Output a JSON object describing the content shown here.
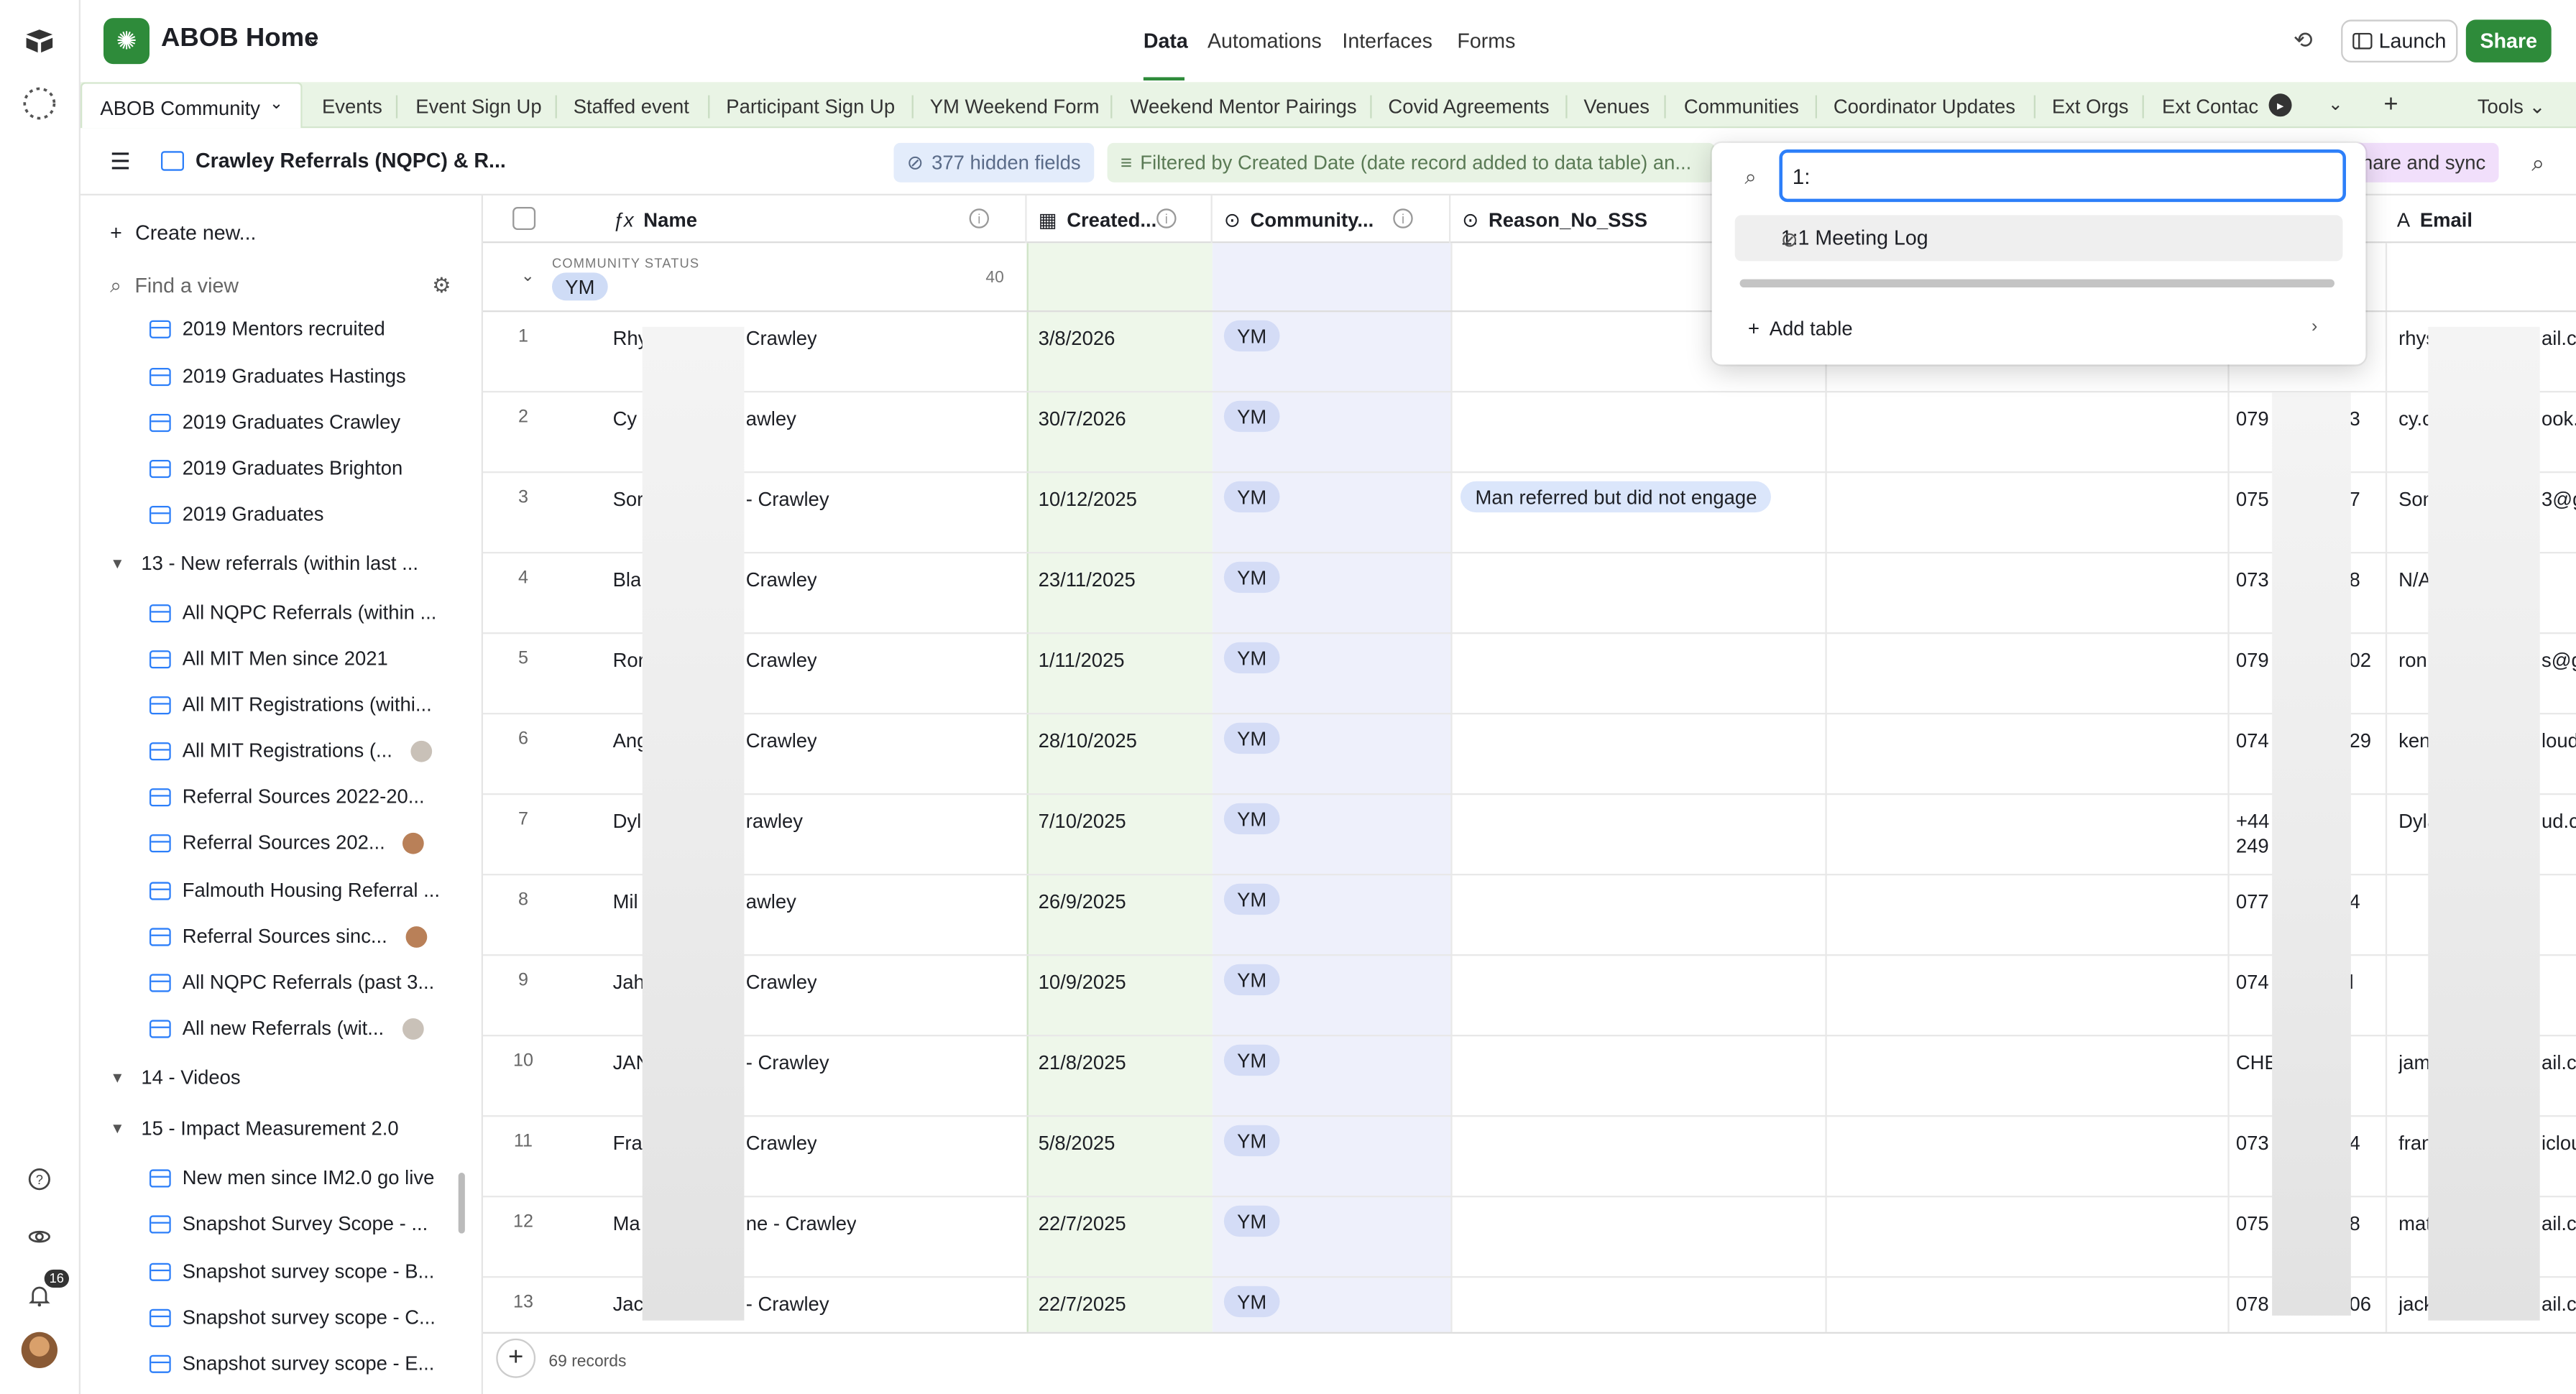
{
  "app": {
    "name": "ABOB Home"
  },
  "nav": {
    "tabs": [
      "Data",
      "Automations",
      "Interfaces",
      "Forms"
    ],
    "active": "Data"
  },
  "header_actions": {
    "launch": "Launch",
    "share": "Share"
  },
  "base_tabs": {
    "active": "ABOB Community",
    "items": [
      "Events",
      "Event Sign Up",
      "Staffed event",
      "Participant Sign Up",
      "YM Weekend Form",
      "Weekend Mentor Pairings",
      "Covid Agreements",
      "Venues",
      "Communities",
      "Coordinator Updates",
      "Ext Orgs",
      "Ext Contac"
    ],
    "tools": "Tools"
  },
  "viewbar": {
    "view_name": "Crawley Referrals (NQPC) & R...",
    "hidden_fields": "377 hidden fields",
    "filter": "Filtered by Created Date (date record added to data table) an...",
    "share_sync": "hare and sync"
  },
  "sidebar": {
    "create_new": "Create new...",
    "find_view": "Find a view",
    "views_a": [
      "2019 Mentors recruited",
      "2019 Graduates Hastings",
      "2019 Graduates Crawley",
      "2019 Graduates Brighton",
      "2019 Graduates"
    ],
    "section_13": "13 - New referrals (within last ...",
    "views_b": [
      "All NQPC Referrals (within ...",
      "All MIT Men since 2021",
      "All MIT Registrations (withi...",
      "All MIT Registrations (...",
      "Referral Sources 2022-20...",
      "Referral Sources 202...",
      "Falmouth Housing Referral ...",
      "Referral Sources sinc...",
      "All NQPC Referrals (past 3...",
      "All new Referrals (wit..."
    ],
    "section_14": "14 - Videos",
    "section_15": "15 - Impact Measurement 2.0",
    "views_c": [
      "New men since IM2.0 go live",
      "Snapshot Survey Scope - ...",
      "Snapshot survey scope - B...",
      "Snapshot survey scope - C...",
      "Snapshot survey scope - E..."
    ],
    "notifications_count": "16"
  },
  "grid": {
    "columns": {
      "name": "Name",
      "created": "Created...",
      "community": "Community...",
      "reason": "Reason_No_SSS",
      "email": "Email"
    },
    "group": {
      "label": "COMMUNITY STATUS",
      "value": "YM",
      "count": "40"
    },
    "rows": [
      {
        "n": "1",
        "name_a": "Rhy",
        "name_b": "Crawley",
        "created": "3/8/2026",
        "comm": "YM",
        "reason": "",
        "phone_a": "",
        "phone_b": "",
        "email_a": "rhys",
        "email_b": "ail.c"
      },
      {
        "n": "2",
        "name_a": "Cy",
        "name_b": "awley",
        "created": "30/7/2026",
        "comm": "YM",
        "reason": "",
        "phone_a": "079",
        "phone_b": "3",
        "email_a": "cy.c",
        "email_b": "ook.c"
      },
      {
        "n": "3",
        "name_a": "Sor",
        "name_b": "- Crawley",
        "created": "10/12/2025",
        "comm": "YM",
        "reason": "Man referred but did not engage",
        "phone_a": "075",
        "phone_b": "7",
        "email_a": "Son",
        "email_b": "3@g"
      },
      {
        "n": "4",
        "name_a": "Bla",
        "name_b": "Crawley",
        "created": "23/11/2025",
        "comm": "YM",
        "reason": "",
        "phone_a": "073",
        "phone_b": "8",
        "email_a": "N/A",
        "email_b": ""
      },
      {
        "n": "5",
        "name_a": "Ror",
        "name_b": "Crawley",
        "created": "1/11/2025",
        "comm": "YM",
        "reason": "",
        "phone_a": "079",
        "phone_b": "02",
        "email_a": "ronr",
        "email_b": "s@g"
      },
      {
        "n": "6",
        "name_a": "Ang",
        "name_b": "Crawley",
        "created": "28/10/2025",
        "comm": "YM",
        "reason": "",
        "phone_a": "074",
        "phone_b": "29",
        "email_a": "keni",
        "email_b": "loud"
      },
      {
        "n": "7",
        "name_a": "Dyl",
        "name_b": "rawley",
        "created": "7/10/2025",
        "comm": "YM",
        "reason": "",
        "phone_a": "+44",
        "phone_b": "",
        "phone_c": "249",
        "email_a": "Dyla",
        "email_b": "ud.c"
      },
      {
        "n": "8",
        "name_a": "Mil",
        "name_b": "awley",
        "created": "26/9/2025",
        "comm": "YM",
        "reason": "",
        "phone_a": "077",
        "phone_b": "4",
        "email_a": "",
        "email_b": ""
      },
      {
        "n": "9",
        "name_a": "Jah",
        "name_b": "Crawley",
        "created": "10/9/2025",
        "comm": "YM",
        "reason": "",
        "phone_a": "074",
        "phone_b": "l",
        "email_a": "",
        "email_b": ""
      },
      {
        "n": "10",
        "name_a": "JAN",
        "name_b": "- Crawley",
        "created": "21/8/2025",
        "comm": "YM",
        "reason": "",
        "phone_a": "CHE",
        "phone_b": "",
        "email_a": "jama",
        "email_b": "ail.c"
      },
      {
        "n": "11",
        "name_a": "Fra",
        "name_b": "Crawley",
        "created": "5/8/2025",
        "comm": "YM",
        "reason": "",
        "phone_a": "073",
        "phone_b": "4",
        "email_a": "fran",
        "email_b": "iclou"
      },
      {
        "n": "12",
        "name_a": "Ma",
        "name_b": "ne - Crawley",
        "created": "22/7/2025",
        "comm": "YM",
        "reason": "",
        "phone_a": "075",
        "phone_b": "8",
        "email_a": "mat",
        "email_b": "ail.c"
      },
      {
        "n": "13",
        "name_a": "Jac",
        "name_b": "- Crawley",
        "created": "22/7/2025",
        "comm": "YM",
        "reason": "",
        "phone_a": "078",
        "phone_b": "06",
        "email_a": "jack",
        "email_b": "ail.c"
      }
    ],
    "records": "69 records"
  },
  "dropdown": {
    "search_value": "1:",
    "item": "1:1 Meeting Log",
    "add_table": "Add table"
  },
  "colors": {
    "brand": "#2e8b3a",
    "focus": "#2d7ff9",
    "tab_bar": "#e9f4e5"
  }
}
